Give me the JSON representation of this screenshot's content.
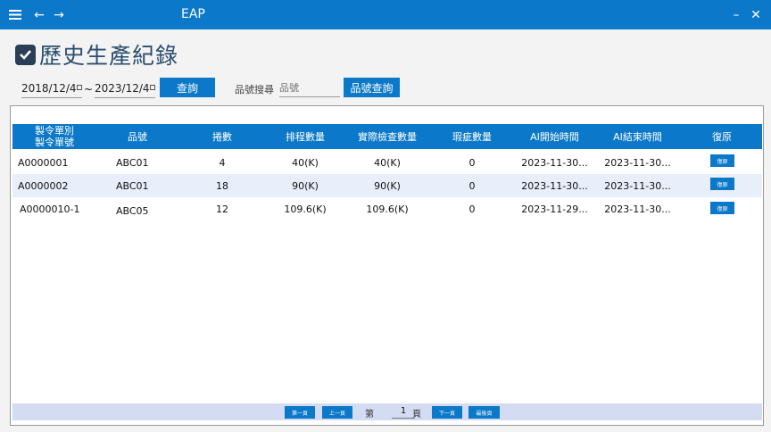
{
  "app": {
    "title": "EAP"
  },
  "page": {
    "title": "歷史生產紀錄"
  },
  "filters": {
    "date_from": "2018/12/4",
    "date_sep": "~",
    "date_to": "2023/12/4",
    "query_label": "查詢",
    "search_label": "品號搜尋",
    "search_placeholder": "品號",
    "search_button": "品號查詢"
  },
  "table": {
    "headers": [
      "製令單別\n製令單號",
      "品號",
      "捲數",
      "排程數量",
      "實際檢查數量",
      "瑕疵數量",
      "AI開始時間",
      "AI結束時間",
      "復原"
    ],
    "rows": [
      {
        "order": "A0000001",
        "part": "ABC01",
        "rolls": "4",
        "scheduled": "40(K)",
        "inspected": "40(K)",
        "defects": "0",
        "ai_start": "2023-11-30...",
        "ai_end": "2023-11-30...",
        "restore": "復原"
      },
      {
        "order": "A0000002",
        "part": "ABC01",
        "rolls": "18",
        "scheduled": "90(K)",
        "inspected": "90(K)",
        "defects": "0",
        "ai_start": "2023-11-30...",
        "ai_end": "2023-11-30...",
        "restore": "復原"
      },
      {
        "order": "A0000010-1",
        "part": "ABC05",
        "rolls": "12",
        "scheduled": "109.6(K)",
        "inspected": "109.6(K)",
        "defects": "0",
        "ai_start": "2023-11-29...",
        "ai_end": "2023-11-30...",
        "restore": "復原"
      }
    ]
  },
  "pager": {
    "first": "第一頁",
    "prev": "上一頁",
    "page_prefix": "第",
    "page": "1",
    "page_suffix": "頁",
    "next": "下一頁",
    "last": "最後頁"
  },
  "colors": {
    "accent": "#0b78c9",
    "alt_row": "#e9eefb",
    "pager_bg": "#d4dcf3"
  }
}
